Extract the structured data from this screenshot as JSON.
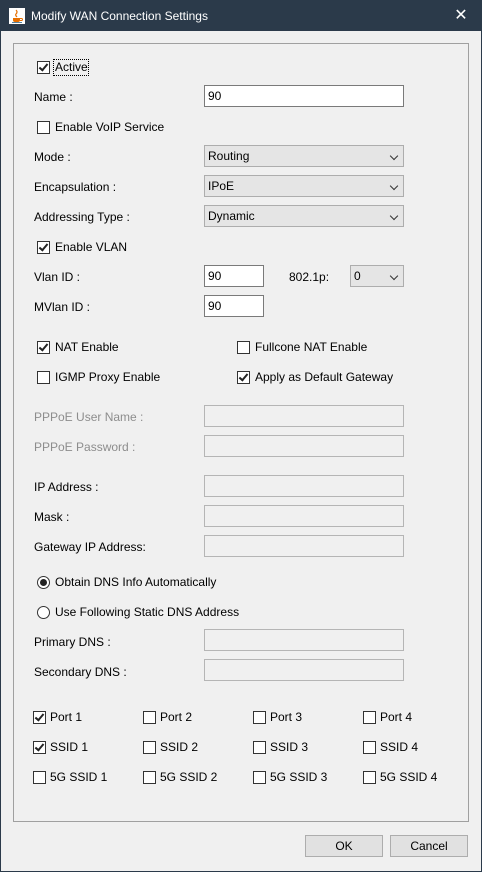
{
  "window": {
    "title": "Modify WAN Connection Settings",
    "close_symbol": "✕"
  },
  "active": {
    "label": "Active",
    "checked": true
  },
  "name": {
    "label": "Name :",
    "value": "90"
  },
  "voip": {
    "label": "Enable VoIP Service",
    "checked": false
  },
  "mode": {
    "label": "Mode :",
    "value": "Routing"
  },
  "encapsulation": {
    "label": "Encapsulation :",
    "value": "IPoE"
  },
  "addressing": {
    "label": "Addressing Type :",
    "value": "Dynamic"
  },
  "vlan": {
    "label": "Enable VLAN",
    "checked": true
  },
  "vlan_id": {
    "label": "Vlan ID :",
    "value": "90"
  },
  "dot1p": {
    "label": "802.1p:",
    "value": "0"
  },
  "mvlan_id": {
    "label": "MVlan ID :",
    "value": "90"
  },
  "nat": {
    "label": "NAT Enable",
    "checked": true
  },
  "fullcone": {
    "label": "Fullcone NAT Enable",
    "checked": false
  },
  "igmp": {
    "label": "IGMP Proxy Enable",
    "checked": false
  },
  "default_gw": {
    "label": "Apply as Default Gateway",
    "checked": true
  },
  "pppoe_user": {
    "label": "PPPoE User Name :",
    "value": ""
  },
  "pppoe_pass": {
    "label": "PPPoE Password :",
    "value": ""
  },
  "ip_address": {
    "label": "IP Address :",
    "value": ""
  },
  "mask": {
    "label": "Mask :",
    "value": ""
  },
  "gateway_ip": {
    "label": "Gateway IP Address:",
    "value": ""
  },
  "dns_auto": {
    "label": "Obtain DNS Info Automatically",
    "checked": true
  },
  "dns_static": {
    "label": "Use Following Static DNS Address",
    "checked": false
  },
  "primary_dns": {
    "label": "Primary DNS :",
    "value": ""
  },
  "secondary_dns": {
    "label": "Secondary DNS :",
    "value": ""
  },
  "bindings": [
    {
      "label": "Port 1",
      "checked": true
    },
    {
      "label": "Port 2",
      "checked": false
    },
    {
      "label": "Port 3",
      "checked": false
    },
    {
      "label": "Port 4",
      "checked": false
    },
    {
      "label": "SSID 1",
      "checked": true
    },
    {
      "label": "SSID 2",
      "checked": false
    },
    {
      "label": "SSID 3",
      "checked": false
    },
    {
      "label": "SSID 4",
      "checked": false
    },
    {
      "label": "5G SSID 1",
      "checked": false
    },
    {
      "label": "5G SSID 2",
      "checked": false
    },
    {
      "label": "5G SSID 3",
      "checked": false
    },
    {
      "label": "5G SSID 4",
      "checked": false
    }
  ],
  "buttons": {
    "ok": "OK",
    "cancel": "Cancel"
  }
}
